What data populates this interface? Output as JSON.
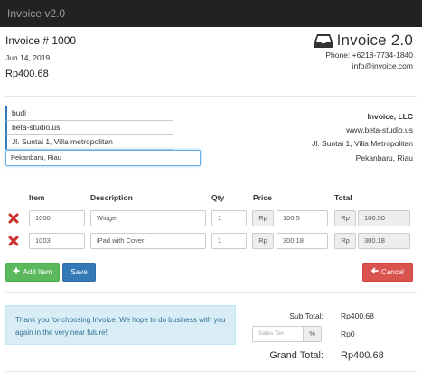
{
  "app": {
    "title": "Invoice v2.0"
  },
  "invoice": {
    "number_label": "Invoice # 1000",
    "date": "Jun 14, 2019",
    "total": "Rp400.68"
  },
  "brand": {
    "name": "Invoice 2.0",
    "icon": "inbox-tray-icon",
    "phone": "Phone: +6218-7734-1840",
    "email": "info@invoice.com"
  },
  "customer": {
    "name": "budi",
    "website": "beta-studio.us",
    "address": "Jl. Suntai 1, Villa metropolitan",
    "city": "Pekanbaru, Riau"
  },
  "company": {
    "name": "Invoice, LLC",
    "website": "www.beta-studio.us",
    "address": "Jl. Suntai 1, Villa Metropolitan",
    "city": "Pekanbaru, Riau"
  },
  "table": {
    "headers": {
      "item": "Item",
      "description": "Description",
      "qty": "Qty",
      "price": "Price",
      "total": "Total"
    },
    "currency": "Rp",
    "rows": [
      {
        "item": "1000",
        "description": "Widget",
        "qty": "1",
        "price": "100.5",
        "total": "100.50"
      },
      {
        "item": "1003",
        "description": "iPad with Cover",
        "qty": "1",
        "price": "300.18",
        "total": "300.18"
      }
    ]
  },
  "buttons": {
    "add_item": "Add Item",
    "save": "Save",
    "cancel": "Cancel"
  },
  "note": "Thank you for choosing Invoice. We hope to do business with you again in the very near future!",
  "summary": {
    "subtotal_label": "Sub Total:",
    "subtotal_value": "Rp400.68",
    "tax_placeholder": "Sales Tax",
    "tax_unit": "%",
    "tax_value": "Rp0",
    "grand_label": "Grand Total:",
    "grand_value": "Rp400.68"
  },
  "colors": {
    "topbar": "#222222",
    "primary": "#337ab7",
    "success": "#5cb85c",
    "danger": "#d9534f",
    "delete_x": "#c9302c",
    "info_bg": "#d9edf7"
  }
}
